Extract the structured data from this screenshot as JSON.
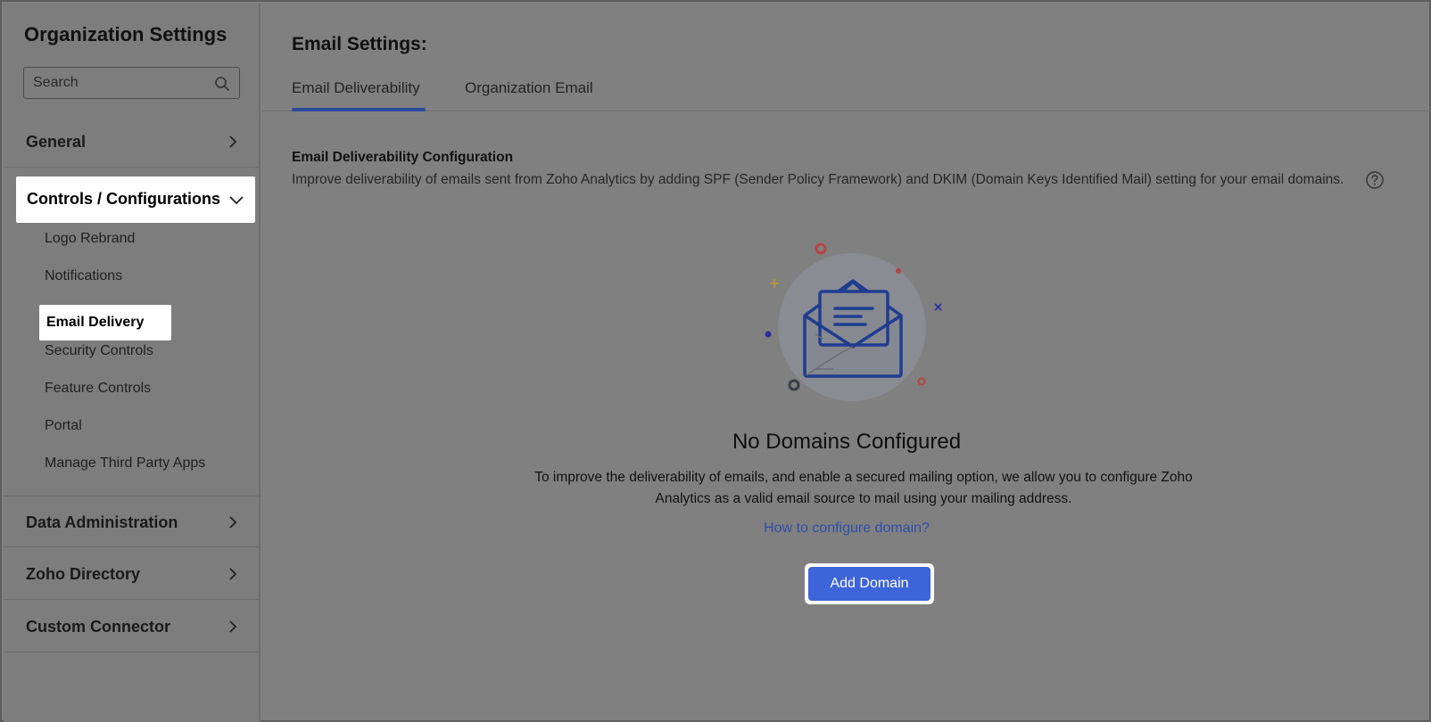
{
  "sidebar": {
    "title": "Organization Settings",
    "search_placeholder": "Search",
    "sections": {
      "general": "General",
      "controls": "Controls / Configurations",
      "data_admin": "Data Administration",
      "zoho_directory": "Zoho Directory",
      "custom_connector": "Custom Connector"
    },
    "controls_items": [
      "Logo Rebrand",
      "Notifications",
      "Email Delivery",
      "Security Controls",
      "Feature Controls",
      "Portal",
      "Manage Third Party Apps"
    ],
    "active_item": "Email Delivery"
  },
  "main": {
    "title": "Email Settings:",
    "tabs": [
      "Email Deliverability",
      "Organization Email"
    ],
    "active_tab": "Email Deliverability",
    "config_title": "Email Deliverability Configuration",
    "config_desc": "Improve deliverability of emails sent from Zoho Analytics by adding SPF (Sender Policy Framework) and DKIM (Domain Keys Identified Mail) setting for your email domains.",
    "empty_title": "No Domains Configured",
    "empty_desc": "To improve the deliverability of emails, and enable a secured mailing option, we allow you to configure Zoho Analytics as a valid email source to mail using your mailing address.",
    "help_link": "How to configure domain?",
    "add_button": "Add Domain"
  },
  "colors": {
    "accent": "#3d64d9",
    "link": "#2e4fa8",
    "overlay": "#808080"
  },
  "icons": {
    "search": "search-icon",
    "chevron": "chevron-right-icon",
    "help": "question-circle-icon",
    "illustration": "envelope-letter-icon"
  }
}
